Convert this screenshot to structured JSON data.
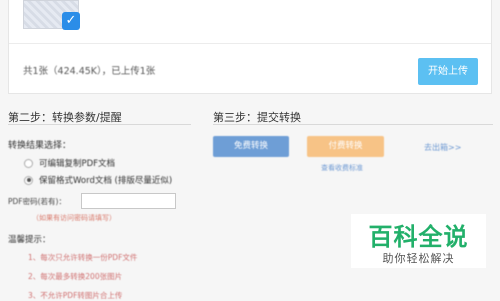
{
  "upload": {
    "status": "共1张（424.45K），已上传1张",
    "start_button": "开始上传"
  },
  "step2": {
    "title": "第二步：转换参数/提醒",
    "result_label": "转换结果选择：",
    "options": [
      {
        "label": "可编辑复制PDF文档",
        "checked": false
      },
      {
        "label": "保留格式Word文档 (排版尽量近似)",
        "checked": true
      }
    ],
    "password_label": "PDF密码(若有)：",
    "password_value": "",
    "password_hint": "（如果有访问密码请填写）",
    "tips_label": "温馨提示：",
    "tips": [
      "1、每次只允许转换一份PDF文件",
      "2、每次最多转换200张图片",
      "3、不允许PDF转图片合上传"
    ]
  },
  "step3": {
    "title": "第三步：提交转换",
    "free_button": "免费转换",
    "paid_button": "付费转换",
    "pricing_link": "查看收费标准",
    "more_link": "去出箱>>"
  },
  "watermark": {
    "title": "百科全说",
    "subtitle": "助你轻松解决"
  }
}
